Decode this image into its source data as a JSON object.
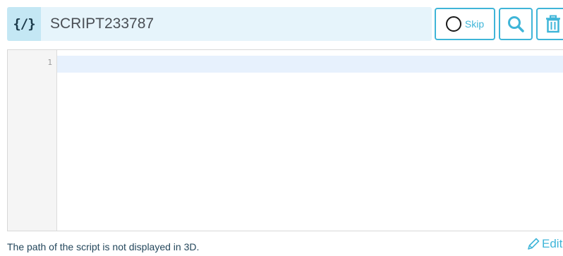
{
  "header": {
    "icon": "code-brackets-icon",
    "icon_text": "{/}",
    "title": "SCRIPT233787"
  },
  "toolbar": {
    "skip_label": "Skip",
    "skip_icon": "circle-icon",
    "search_icon": "search-icon",
    "delete_icon": "trash-icon"
  },
  "editor": {
    "line_numbers": [
      "1"
    ],
    "content": ""
  },
  "footer": {
    "note": "The path of the script is not displayed in 3D.",
    "edit_label": "Edit",
    "edit_icon": "pencil-icon"
  },
  "colors": {
    "accent": "#3fb5d8",
    "header_bg": "#e6f4fb",
    "badge_bg": "#c4e7f4",
    "active_line": "#e7f1fd"
  }
}
